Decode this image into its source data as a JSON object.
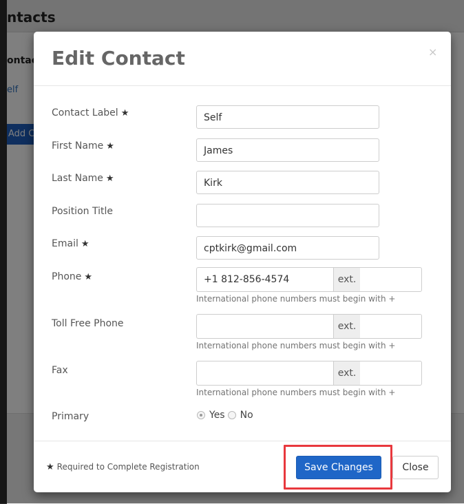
{
  "background": {
    "page_title": "ntacts",
    "column_header": "ontac",
    "cell_value": "elf",
    "add_button": "Add C"
  },
  "modal": {
    "title": "Edit Contact",
    "close_symbol": "×",
    "required_symbol": "★",
    "fields": {
      "contact_label": {
        "label": "Contact Label",
        "value": "Self"
      },
      "first_name": {
        "label": "First Name",
        "value": "James"
      },
      "last_name": {
        "label": "Last Name",
        "value": "Kirk"
      },
      "position_title": {
        "label": "Position Title",
        "value": ""
      },
      "email": {
        "label": "Email",
        "value": "cptkirk@gmail.com"
      },
      "phone": {
        "label": "Phone",
        "value": "+1 812-856-4574",
        "ext_label": "ext.",
        "ext_value": "",
        "help": "International phone numbers must begin with +"
      },
      "toll_free_phone": {
        "label": "Toll Free Phone",
        "value": "",
        "ext_label": "ext.",
        "ext_value": "",
        "help": "International phone numbers must begin with +"
      },
      "fax": {
        "label": "Fax",
        "value": "",
        "ext_label": "ext.",
        "ext_value": "",
        "help": "International phone numbers must begin with +"
      },
      "primary": {
        "label": "Primary",
        "options": [
          "Yes",
          "No"
        ],
        "selected": "Yes"
      }
    },
    "footer": {
      "required_note": "Required to Complete Registration",
      "save_label": "Save Changes",
      "close_label": "Close"
    }
  },
  "colors": {
    "primary_button": "#1f66c7",
    "highlight_box": "#e8383d"
  }
}
